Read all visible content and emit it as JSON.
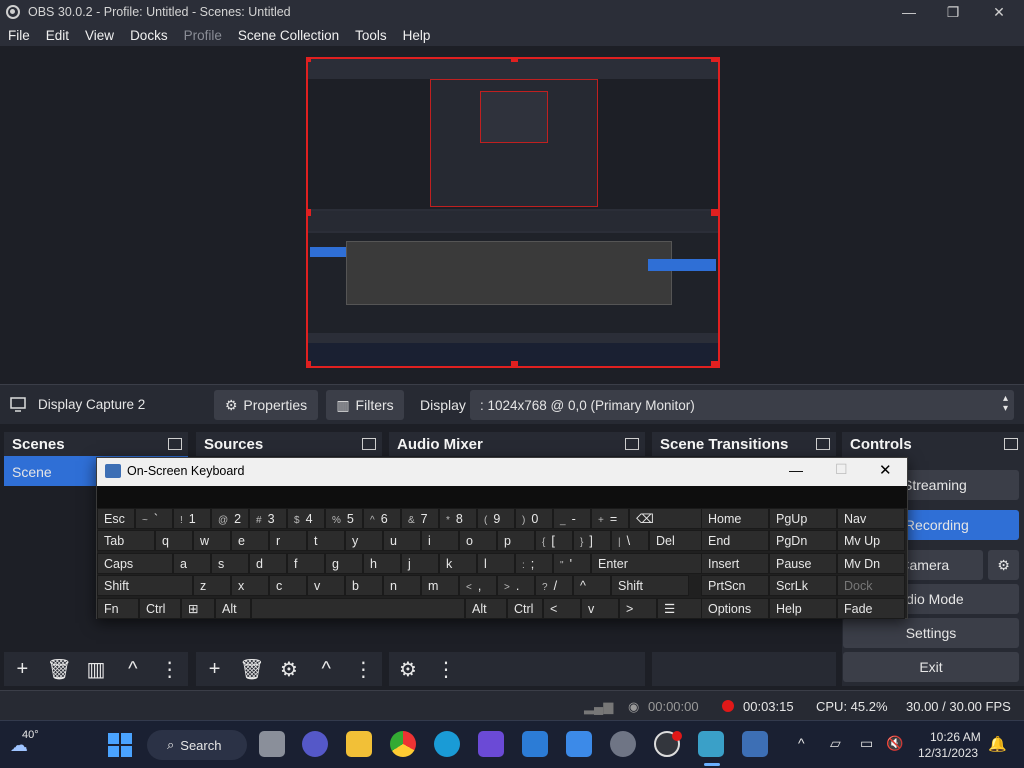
{
  "window": {
    "title": "OBS 30.0.2 - Profile: Untitled - Scenes: Untitled",
    "minimize": "—",
    "maximize": "❐",
    "close": "✕"
  },
  "menu": [
    "File",
    "Edit",
    "View",
    "Docks",
    "Profile",
    "Scene Collection",
    "Tools",
    "Help"
  ],
  "source_toolbar": {
    "source_name": "Display Capture 2",
    "properties": "Properties",
    "filters": "Filters",
    "display_label": "Display",
    "display_value": ": 1024x768 @ 0,0 (Primary Monitor)"
  },
  "docks": {
    "scenes": {
      "title": "Scenes",
      "items": [
        "Scene"
      ]
    },
    "sources": {
      "title": "Sources"
    },
    "audio_mixer": {
      "title": "Audio Mixer"
    },
    "scene_transitions": {
      "title": "Scene Transitions"
    },
    "controls": {
      "title": "Controls",
      "buttons": [
        "t Streaming",
        "o Recording",
        "ual Camera",
        "udio Mode",
        "Settings",
        "Exit"
      ]
    }
  },
  "status": {
    "network_time": "00:00:00",
    "recording_time": "00:03:15",
    "cpu": "CPU: 45.2%",
    "fps": "30.00 / 30.00 FPS"
  },
  "osk": {
    "title": "On-Screen Keyboard",
    "rows": [
      [
        {
          "p": "Esc"
        },
        {
          "s": "~",
          "p": "`"
        },
        {
          "s": "!",
          "p": "1"
        },
        {
          "s": "@",
          "p": "2"
        },
        {
          "s": "#",
          "p": "3"
        },
        {
          "s": "$",
          "p": "4"
        },
        {
          "s": "%",
          "p": "5"
        },
        {
          "s": "^",
          "p": "6"
        },
        {
          "s": "&",
          "p": "7"
        },
        {
          "s": "*",
          "p": "8"
        },
        {
          "s": "(",
          "p": "9"
        },
        {
          "s": ")",
          "p": "0"
        },
        {
          "s": "_",
          "p": "-"
        },
        {
          "s": "+",
          "p": "="
        },
        {
          "p": "⌫"
        }
      ],
      [
        {
          "p": "Tab"
        },
        {
          "p": "q"
        },
        {
          "p": "w"
        },
        {
          "p": "e"
        },
        {
          "p": "r"
        },
        {
          "p": "t"
        },
        {
          "p": "y"
        },
        {
          "p": "u"
        },
        {
          "p": "i"
        },
        {
          "p": "o"
        },
        {
          "p": "p"
        },
        {
          "s": "{",
          "p": "["
        },
        {
          "s": "}",
          "p": "]"
        },
        {
          "s": "|",
          "p": "\\"
        },
        {
          "p": "Del"
        }
      ],
      [
        {
          "p": "Caps"
        },
        {
          "p": "a"
        },
        {
          "p": "s"
        },
        {
          "p": "d"
        },
        {
          "p": "f"
        },
        {
          "p": "g"
        },
        {
          "p": "h"
        },
        {
          "p": "j"
        },
        {
          "p": "k"
        },
        {
          "p": "l"
        },
        {
          "s": ":",
          "p": ";"
        },
        {
          "s": "\"",
          "p": "'"
        },
        {
          "p": "Enter"
        }
      ],
      [
        {
          "p": "Shift"
        },
        {
          "p": "z"
        },
        {
          "p": "x"
        },
        {
          "p": "c"
        },
        {
          "p": "v"
        },
        {
          "p": "b"
        },
        {
          "p": "n"
        },
        {
          "p": "m"
        },
        {
          "s": "<",
          "p": ","
        },
        {
          "s": ">",
          "p": "."
        },
        {
          "s": "?",
          "p": "/"
        },
        {
          "p": "^"
        },
        {
          "p": "Shift"
        }
      ],
      [
        {
          "p": "Fn"
        },
        {
          "p": "Ctrl"
        },
        {
          "p": "⊞"
        },
        {
          "p": "Alt"
        },
        {
          "p": ""
        },
        {
          "p": "Alt"
        },
        {
          "p": "Ctrl"
        },
        {
          "p": "<"
        },
        {
          "p": "v"
        },
        {
          "p": ">"
        },
        {
          "p": "☰"
        }
      ]
    ],
    "nav_keys": [
      [
        "Home",
        "PgUp",
        "Nav"
      ],
      [
        "End",
        "PgDn",
        "Mv Up"
      ],
      [
        "Insert",
        "Pause",
        "Mv Dn"
      ],
      [
        "PrtScn",
        "ScrLk",
        "Dock"
      ],
      [
        "Options",
        "Help",
        "Fade"
      ]
    ]
  },
  "taskbar": {
    "weather": "40°",
    "search": "Search",
    "time": "10:26 AM",
    "date": "12/31/2023"
  }
}
